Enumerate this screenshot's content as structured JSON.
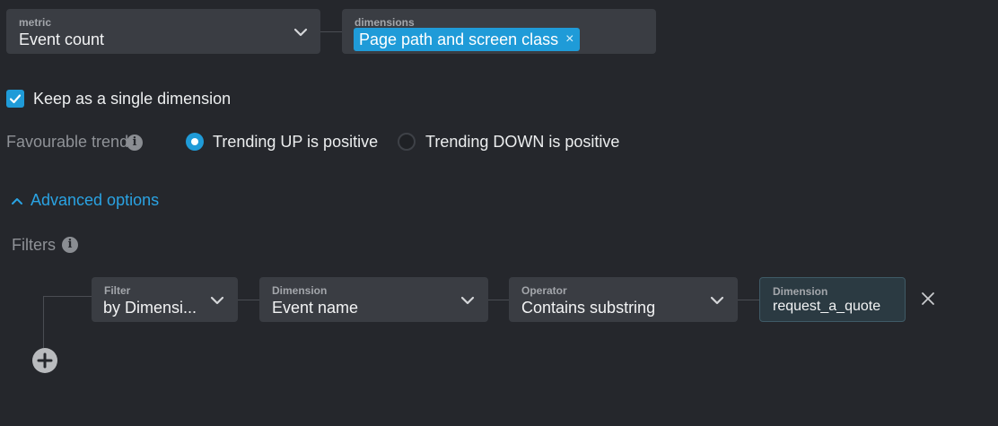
{
  "metric": {
    "label": "metric",
    "value": "Event count"
  },
  "dimensions": {
    "label": "dimensions",
    "chip": "Page path and screen class",
    "chip_remove": "×"
  },
  "keep_single": {
    "label": "Keep as a single dimension",
    "checked": true
  },
  "trend": {
    "label": "Favourable trend",
    "option_up": "Trending UP is positive",
    "option_down": "Trending DOWN is positive",
    "selected": "up"
  },
  "advanced": {
    "label": "Advanced options",
    "expanded": true
  },
  "filters": {
    "label": "Filters",
    "row": {
      "filter_label": "Filter",
      "filter_value": "by Dimensi...",
      "dimension_label": "Dimension",
      "dimension_value": "Event name",
      "operator_label": "Operator",
      "operator_value": "Contains substring",
      "value_label": "Dimension",
      "value": "request_a_quote"
    }
  },
  "colors": {
    "background": "#25272c",
    "accent": "#1f9bd8",
    "field": "#3a3d43"
  }
}
